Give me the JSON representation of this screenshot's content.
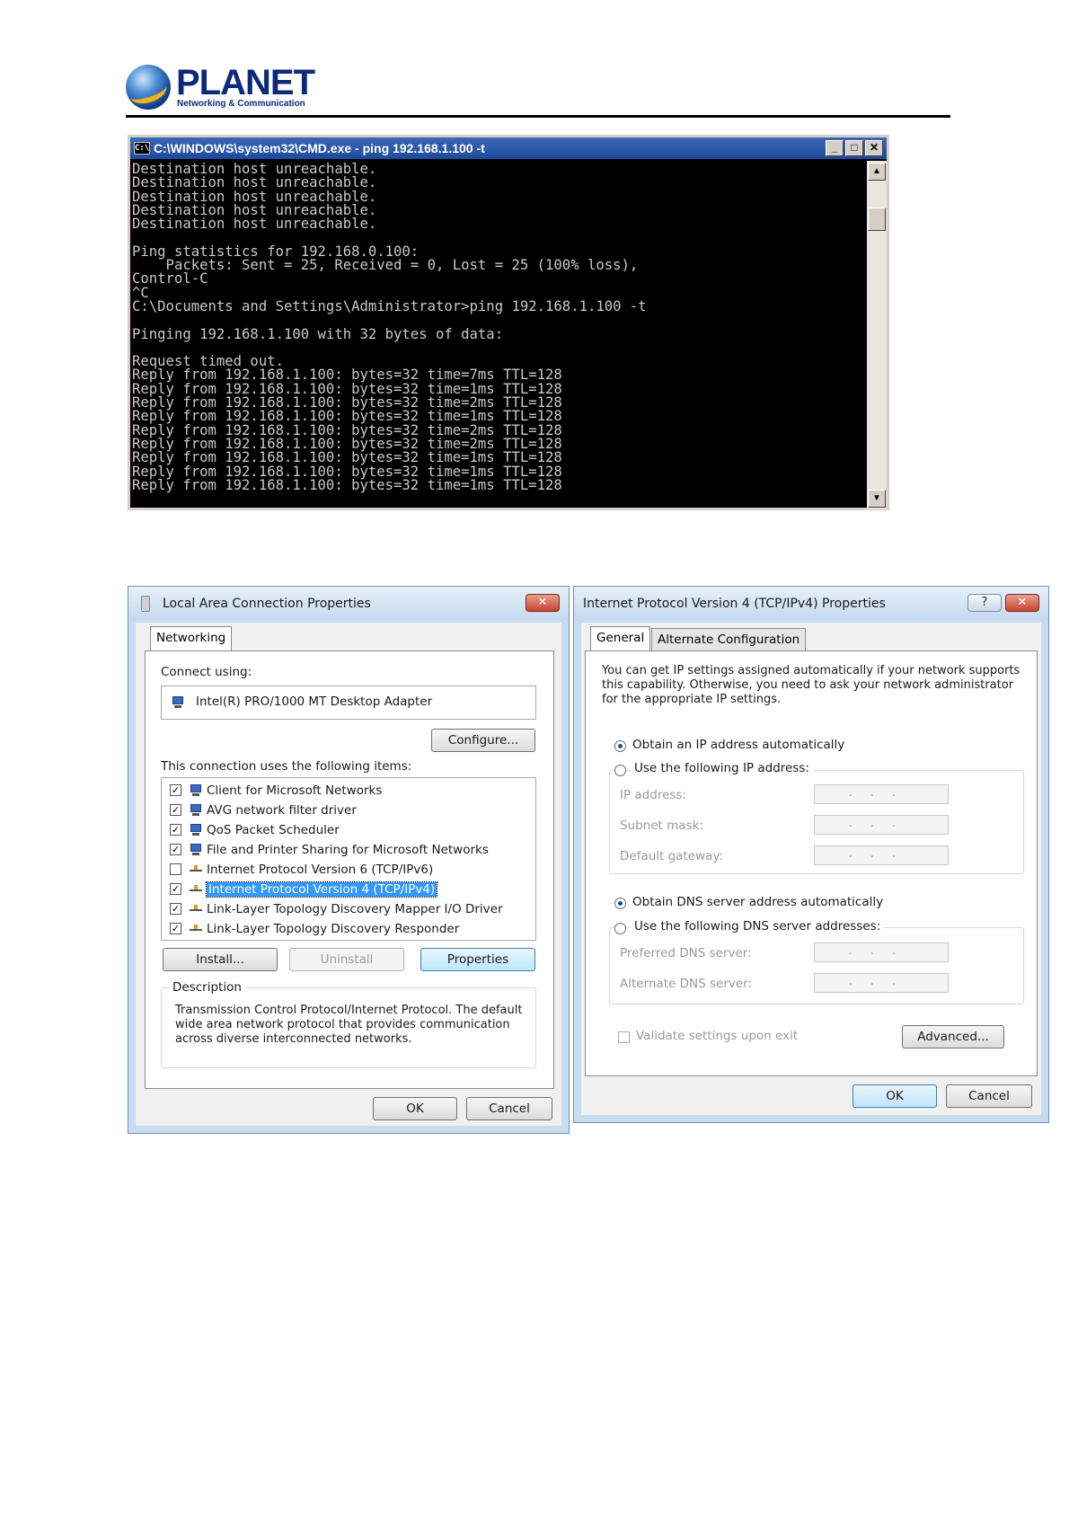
{
  "header": {
    "brand": "PLANET",
    "tagline": "Networking & Communication"
  },
  "cmd": {
    "title": "C:\\WINDOWS\\system32\\CMD.exe - ping 192.168.1.100 -t",
    "icon": "cmd-icon",
    "lines": [
      "Destination host unreachable.",
      "Destination host unreachable.",
      "Destination host unreachable.",
      "Destination host unreachable.",
      "Destination host unreachable.",
      "",
      "Ping statistics for 192.168.0.100:",
      "    Packets: Sent = 25, Received = 0, Lost = 25 (100% loss),",
      "Control-C",
      "^C",
      "C:\\Documents and Settings\\Administrator>ping 192.168.1.100 -t",
      "",
      "Pinging 192.168.1.100 with 32 bytes of data:",
      "",
      "Request timed out.",
      "Reply from 192.168.1.100: bytes=32 time=7ms TTL=128",
      "Reply from 192.168.1.100: bytes=32 time=1ms TTL=128",
      "Reply from 192.168.1.100: bytes=32 time=2ms TTL=128",
      "Reply from 192.168.1.100: bytes=32 time=1ms TTL=128",
      "Reply from 192.168.1.100: bytes=32 time=2ms TTL=128",
      "Reply from 192.168.1.100: bytes=32 time=2ms TTL=128",
      "Reply from 192.168.1.100: bytes=32 time=1ms TTL=128",
      "Reply from 192.168.1.100: bytes=32 time=1ms TTL=128",
      "Reply from 192.168.1.100: bytes=32 time=1ms TTL=128"
    ]
  },
  "lan": {
    "title": "Local Area Connection Properties",
    "tab": "Networking",
    "connect_using": "Connect using:",
    "adapter": "Intel(R) PRO/1000 MT Desktop Adapter",
    "configure": "Configure...",
    "items_label": "This connection uses the following items:",
    "items": [
      {
        "label": "Client for Microsoft Networks",
        "checked": true,
        "icon": "network-client-icon"
      },
      {
        "label": "AVG network filter driver",
        "checked": true,
        "icon": "network-service-icon"
      },
      {
        "label": "QoS Packet Scheduler",
        "checked": true,
        "icon": "network-service-icon"
      },
      {
        "label": "File and Printer Sharing for Microsoft Networks",
        "checked": true,
        "icon": "network-service-icon"
      },
      {
        "label": "Internet Protocol Version 6 (TCP/IPv6)",
        "checked": false,
        "icon": "protocol-icon"
      },
      {
        "label": "Internet Protocol Version 4 (TCP/IPv4)",
        "checked": true,
        "icon": "protocol-icon",
        "selected": true
      },
      {
        "label": "Link-Layer Topology Discovery Mapper I/O Driver",
        "checked": true,
        "icon": "protocol-icon"
      },
      {
        "label": "Link-Layer Topology Discovery Responder",
        "checked": true,
        "icon": "protocol-icon"
      }
    ],
    "install": "Install...",
    "uninstall": "Uninstall",
    "properties": "Properties",
    "description_label": "Description",
    "description": "Transmission Control Protocol/Internet Protocol. The default wide area network protocol that provides communication across diverse interconnected networks.",
    "ok": "OK",
    "cancel": "Cancel",
    "close": "✕"
  },
  "ipv4": {
    "title": "Internet Protocol Version 4 (TCP/IPv4) Properties",
    "tab_general": "General",
    "tab_alternate": "Alternate Configuration",
    "intro": "You can get IP settings assigned automatically if your network supports this capability. Otherwise, you need to ask your network administrator for the appropriate IP settings.",
    "obtain_ip": "Obtain an IP address automatically",
    "use_ip": "Use the following IP address:",
    "ip_address": "IP address:",
    "subnet_mask": "Subnet mask:",
    "default_gateway": "Default gateway:",
    "obtain_dns": "Obtain DNS server address automatically",
    "use_dns": "Use the following DNS server addresses:",
    "preferred_dns": "Preferred DNS server:",
    "alternate_dns": "Alternate DNS server:",
    "validate": "Validate settings upon exit",
    "advanced": "Advanced...",
    "ok": "OK",
    "cancel": "Cancel",
    "help": "?",
    "close": "✕",
    "dots": "..."
  }
}
